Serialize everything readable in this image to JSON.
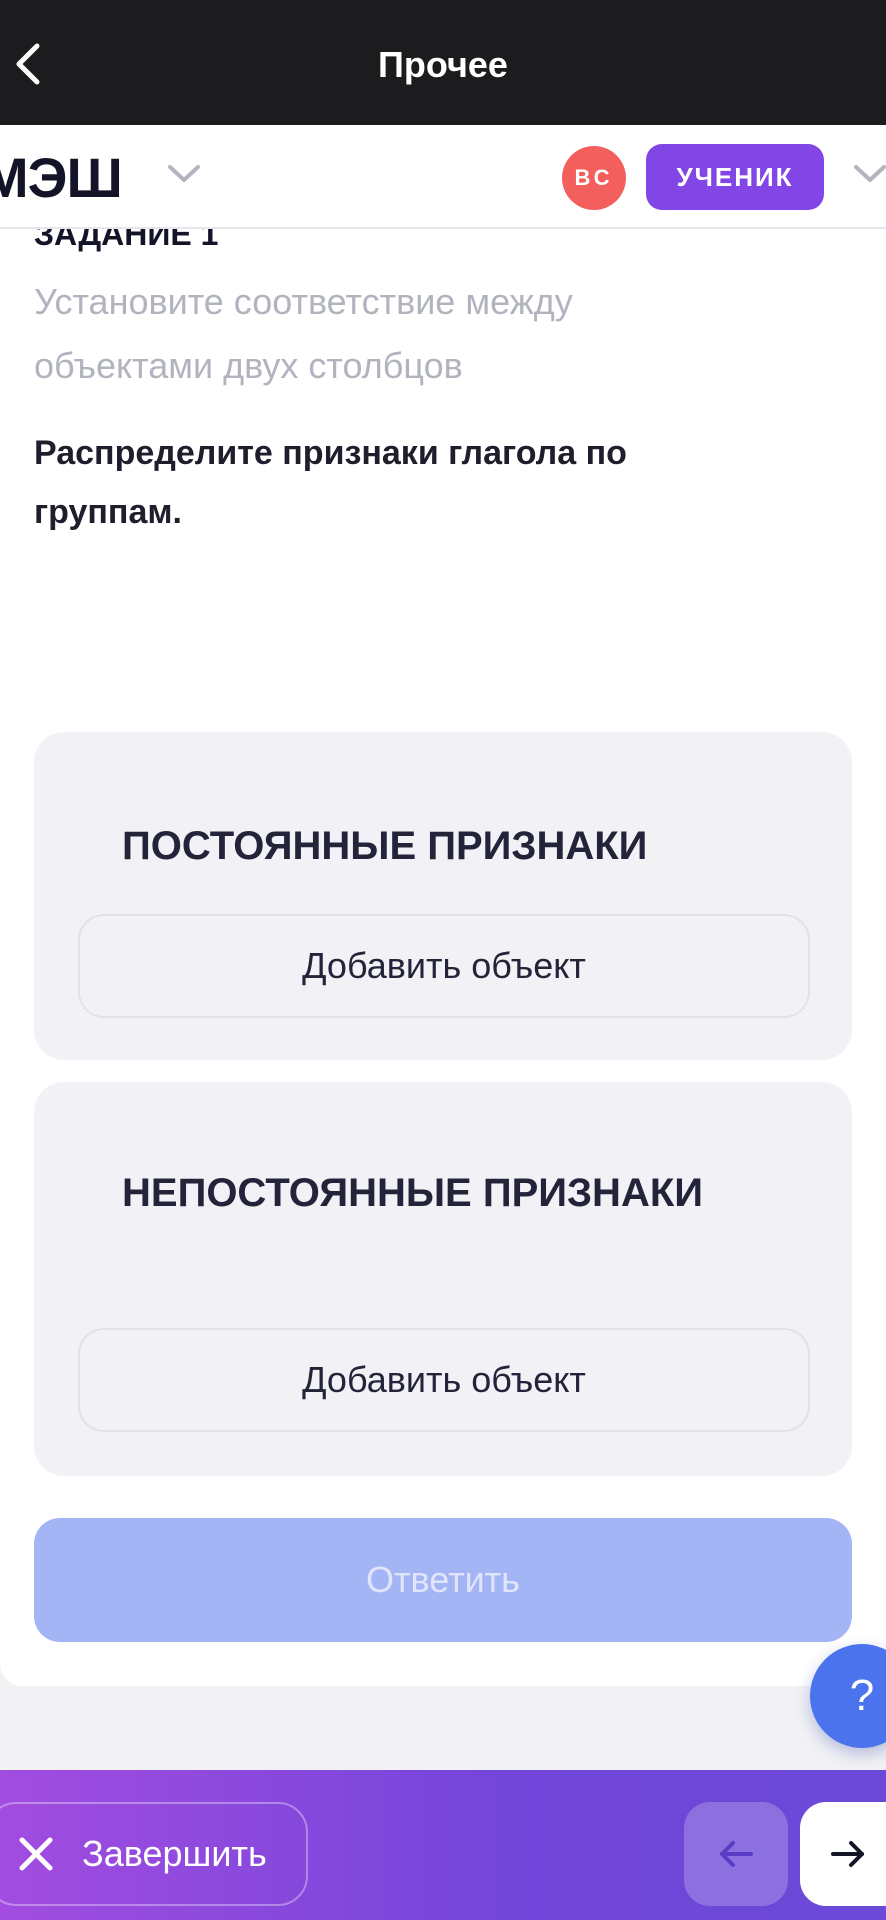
{
  "topbar": {
    "title": "Прочее"
  },
  "app": {
    "logo": "МЭШ",
    "avatar_initials": "ВС",
    "role": "УЧЕНИК"
  },
  "task": {
    "label": "ЗАДАНИЕ 1",
    "instruction": "Установите соответствие между объектами двух столбцов",
    "question": "Распределите признаки глагола по группам."
  },
  "groups": [
    {
      "title": "ПОСТОЯННЫЕ ПРИЗНАКИ",
      "add_label": "Добавить объект"
    },
    {
      "title": "НЕПОСТОЯННЫЕ ПРИЗНАКИ",
      "add_label": "Добавить объект"
    }
  ],
  "submit_label": "Ответить",
  "help_label": "?",
  "footer": {
    "finish_label": "Завершить"
  },
  "icons": [
    "back-icon",
    "chevron-down-icon",
    "close-icon",
    "arrow-left-icon",
    "arrow-right-icon"
  ],
  "colors": {
    "accent": "#8246e6",
    "submit": "#a4b5f5",
    "help": "#4b73ee",
    "avatar": "#f25f5c"
  }
}
